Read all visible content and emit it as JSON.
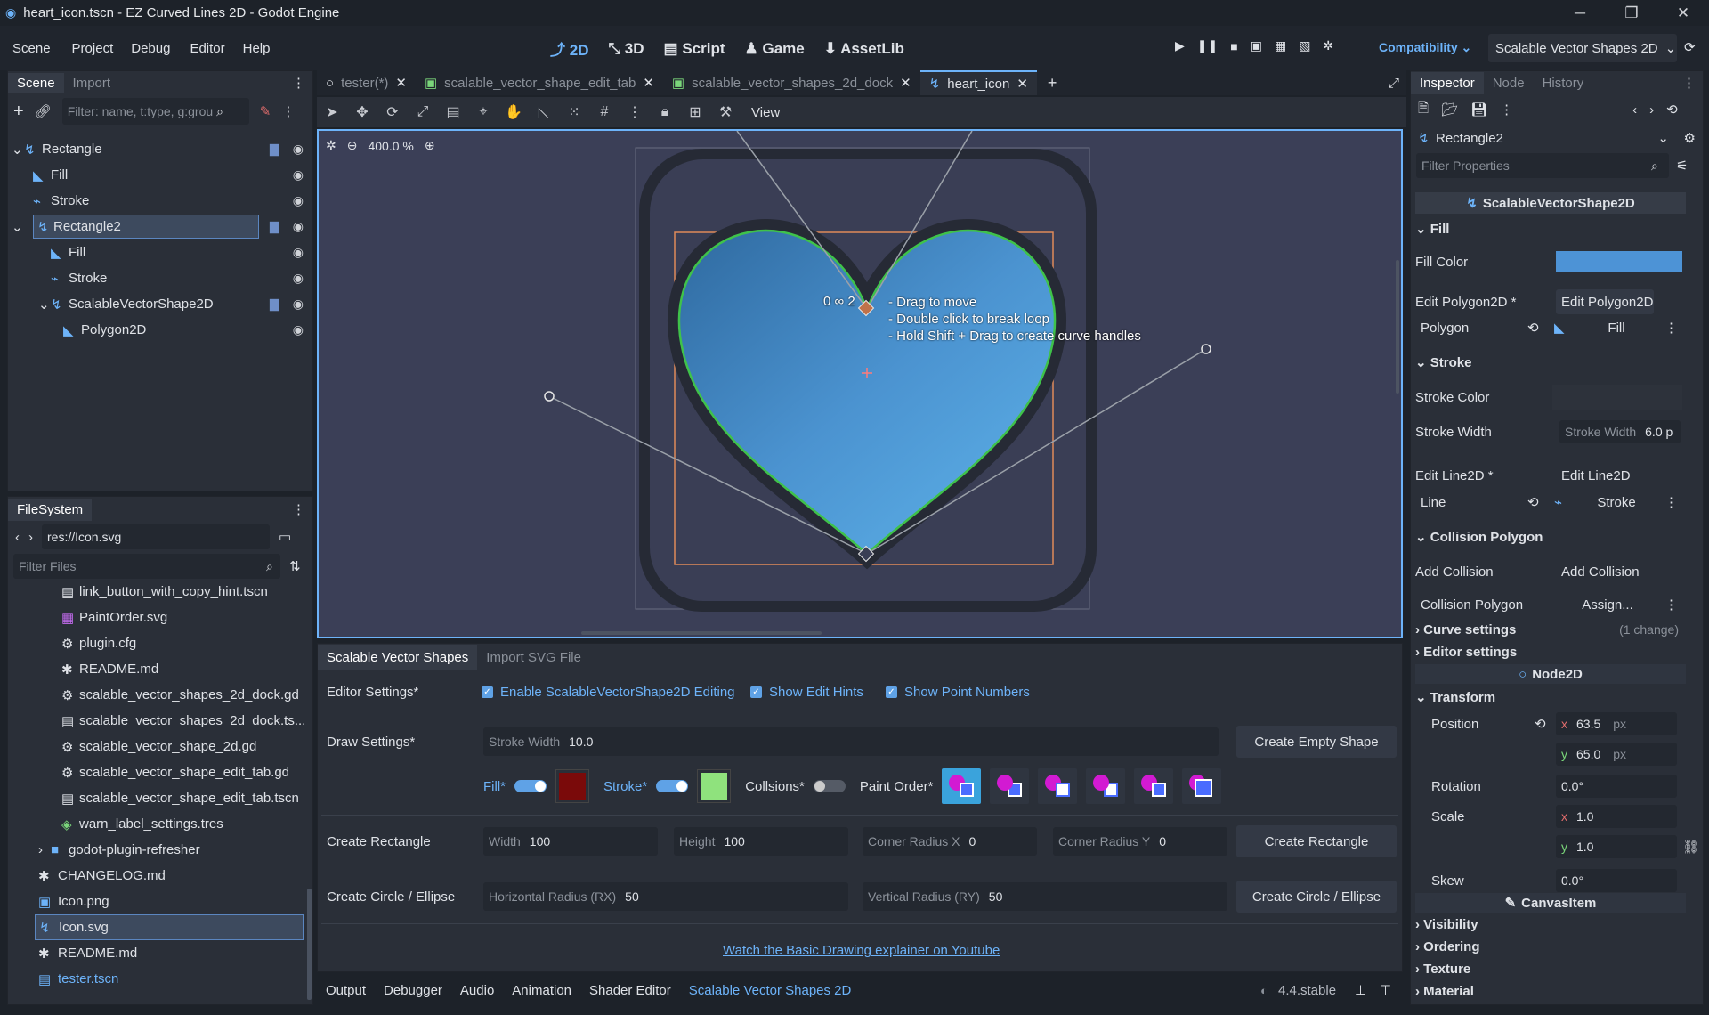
{
  "window": {
    "title": "heart_icon.tscn - EZ Curved Lines 2D - Godot Engine"
  },
  "menu": [
    "Scene",
    "Project",
    "Debug",
    "Editor",
    "Help"
  ],
  "workspaces": [
    "2D",
    "3D",
    "Script",
    "Game",
    "AssetLib"
  ],
  "renderer": "Compatibility",
  "main_screen": "Scalable Vector Shapes 2D",
  "scene_dock": {
    "tabs": [
      "Scene",
      "Import"
    ],
    "filter_placeholder": "Filter: name, t:type, g:grou",
    "nodes": [
      {
        "name": "Rectangle",
        "depth": 0
      },
      {
        "name": "Fill",
        "depth": 1
      },
      {
        "name": "Stroke",
        "depth": 1
      },
      {
        "name": "Rectangle2",
        "depth": 1
      },
      {
        "name": "Fill",
        "depth": 2
      },
      {
        "name": "Stroke",
        "depth": 2
      },
      {
        "name": "ScalableVectorShape2D",
        "depth": 2
      },
      {
        "name": "Polygon2D",
        "depth": 3
      }
    ]
  },
  "filesystem": {
    "tab": "FileSystem",
    "path": "res://Icon.svg",
    "filter_placeholder": "Filter Files",
    "files": [
      "link_button_with_copy_hint.tscn",
      "PaintOrder.svg",
      "plugin.cfg",
      "README.md",
      "scalable_vector_shapes_2d_dock.gd",
      "scalable_vector_shapes_2d_dock.ts...",
      "scalable_vector_shape_2d.gd",
      "scalable_vector_shape_edit_tab.gd",
      "scalable_vector_shape_edit_tab.tscn",
      "warn_label_settings.tres",
      "godot-plugin-refresher",
      "CHANGELOG.md",
      "Icon.png",
      "Icon.svg",
      "README.md",
      "tester.tscn"
    ]
  },
  "editor_tabs": [
    "tester(*)",
    "scalable_vector_shape_edit_tab",
    "scalable_vector_shapes_2d_dock",
    "heart_icon"
  ],
  "toolbar": {
    "view": "View"
  },
  "zoom": "400.0 %",
  "hints": {
    "index": "0 ∞ 2",
    "lines": [
      "- Drag to move",
      "- Double click to break loop",
      "- Hold Shift + Drag to create curve handles"
    ]
  },
  "svs_panel": {
    "tabs": [
      "Scalable Vector Shapes",
      "Import SVG File"
    ],
    "editor_settings_label": "Editor Settings*",
    "checks": [
      "Enable ScalableVectorShape2D Editing",
      "Show Edit Hints",
      "Show Point Numbers"
    ],
    "draw_settings_label": "Draw Settings*",
    "stroke_width_label": "Stroke Width",
    "stroke_width": "10.0",
    "create_empty": "Create Empty Shape",
    "fill_label": "Fill*",
    "stroke_label": "Stroke*",
    "collisions_label": "Collsions*",
    "paint_order_label": "Paint Order*",
    "create_rect_label": "Create Rectangle",
    "width_label": "Width",
    "width": "100",
    "height_label": "Height",
    "height": "100",
    "crx_label": "Corner Radius X",
    "crx": "0",
    "cry_label": "Corner Radius Y",
    "cry": "0",
    "create_rect_btn": "Create Rectangle",
    "create_circle_label": "Create Circle / Ellipse",
    "rx_label": "Horizontal Radius (RX)",
    "rx": "50",
    "ry_label": "Vertical Radius (RY)",
    "ry": "50",
    "create_circle_btn": "Create Circle / Ellipse",
    "link": "Watch the Basic Drawing explainer on Youtube",
    "fill_color": "#7a0a0a",
    "stroke_color": "#8fe27d"
  },
  "bottom_tabs": [
    "Output",
    "Debugger",
    "Audio",
    "Animation",
    "Shader Editor",
    "Scalable Vector Shapes 2D"
  ],
  "version": "4.4.stable",
  "inspector": {
    "tabs": [
      "Inspector",
      "Node",
      "History"
    ],
    "node": "Rectangle2",
    "filter_placeholder": "Filter Properties",
    "class": "ScalableVectorShape2D",
    "fill_section": "Fill",
    "fill_color_label": "Fill Color",
    "fill_color": "#4d93d6",
    "edit_polygon_label": "Edit Polygon2D *",
    "edit_polygon_btn": "Edit Polygon2D",
    "polygon_label": "Polygon",
    "polygon_value": "Fill",
    "stroke_section": "Stroke",
    "stroke_color_label": "Stroke Color",
    "stroke_width_label": "Stroke Width",
    "stroke_width_field": "Stroke Width",
    "stroke_width": "6.0 p",
    "edit_line_label": "Edit Line2D *",
    "edit_line_btn": "Edit Line2D",
    "line_label": "Line",
    "line_value": "Stroke",
    "collision_section": "Collision Polygon",
    "add_collision_label": "Add Collision",
    "add_collision_btn": "Add Collision",
    "collision_polygon_label": "Collision Polygon",
    "assign": "Assign...",
    "curve_settings": "Curve settings",
    "curve_changes": "(1 change)",
    "editor_settings": "Editor settings",
    "node2d": "Node2D",
    "transform": "Transform",
    "position_label": "Position",
    "pos_x": "63.5",
    "pos_y": "65.0",
    "px": "px",
    "rotation_label": "Rotation",
    "rotation": "0.0",
    "deg": "°",
    "scale_label": "Scale",
    "scale_x": "1.0",
    "scale_y": "1.0",
    "skew_label": "Skew",
    "skew": "0.0",
    "canvasitem": "CanvasItem",
    "collapsed": [
      "Visibility",
      "Ordering",
      "Texture",
      "Material"
    ]
  }
}
